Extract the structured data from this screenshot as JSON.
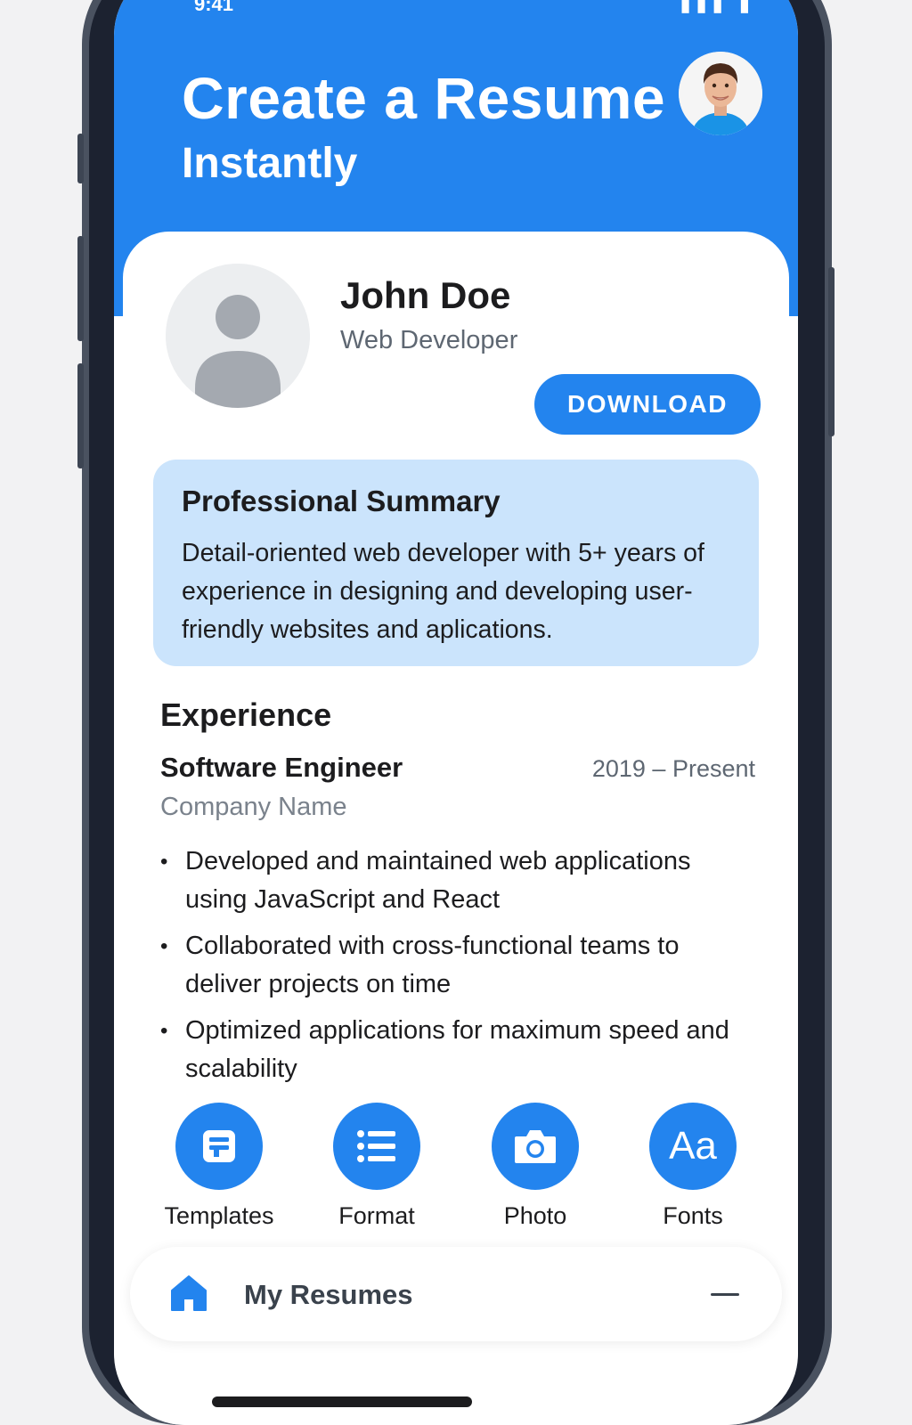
{
  "status_bar": {
    "left": "9:41",
    "right": "▮▮▮ ▮"
  },
  "header": {
    "title_line1": "Create a Resume",
    "title_line2": "Instantly"
  },
  "profile": {
    "name": "John Doe",
    "role": "Web Developer",
    "download_label": "DOWNLOAD"
  },
  "summary": {
    "title": "Professional Summary",
    "text": "Detail-oriented web developer with 5+ years of experience in designing and developing user-friendly websites and aplications."
  },
  "experience": {
    "heading": "Experience",
    "job_title": "Software Engineer",
    "dates": "2019 – Present",
    "company": "Company Name",
    "bullets": [
      "Developed and maintained web applications using JavaScript and React",
      "Collaborated with cross-functional teams to deliver projects on time",
      "Optimized applications for maximum speed and scalability"
    ]
  },
  "toolbar": {
    "items": [
      {
        "label": "Templates",
        "icon": "templates-icon"
      },
      {
        "label": "Format",
        "icon": "list-icon"
      },
      {
        "label": "Photo",
        "icon": "camera-icon"
      },
      {
        "label": "Fonts",
        "icon": "fonts-icon",
        "glyph": "Aa"
      }
    ]
  },
  "bottom_nav": {
    "label": "My Resumes",
    "icon": "home-icon",
    "action_icon": "minus-icon"
  },
  "colors": {
    "primary": "#2384ee",
    "summary_bg": "#cbe4fc",
    "text": "#1c1c1e",
    "muted": "#5e6772"
  }
}
